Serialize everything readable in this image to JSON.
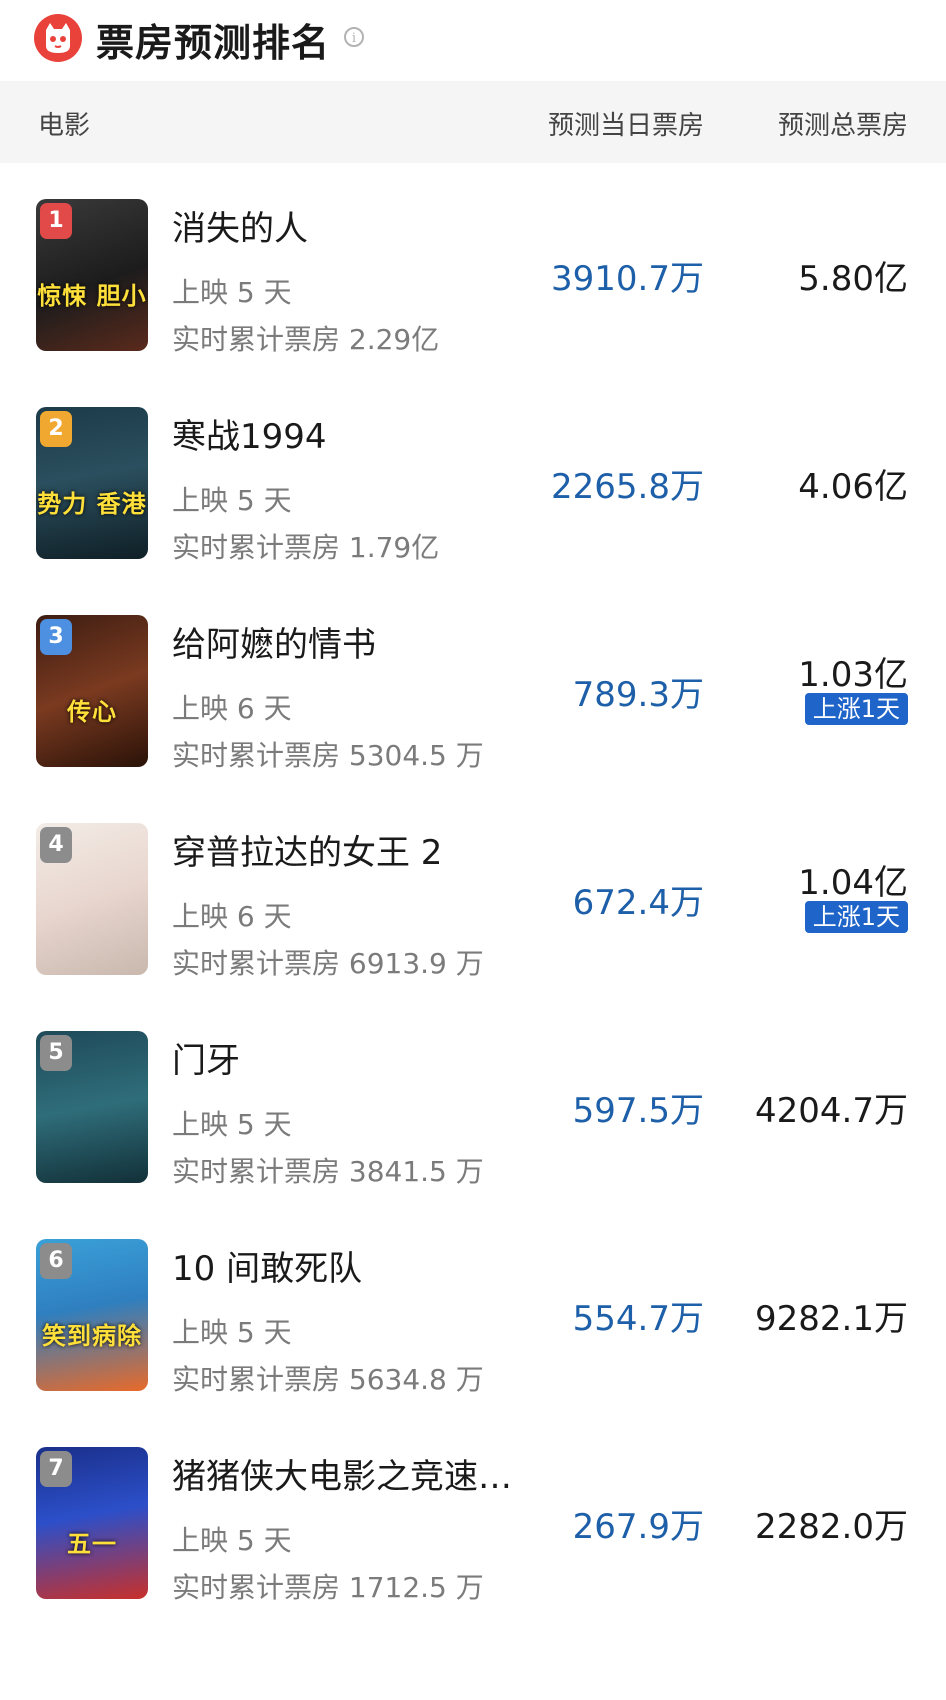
{
  "header": {
    "title": "票房预测排名",
    "info_icon": "info-icon"
  },
  "columns": {
    "film": "电影",
    "today": "预测当日票房",
    "total": "预测总票房"
  },
  "colors": {
    "accent_blue": "#1d5fa8",
    "badge_blue": "#1f64c8",
    "rank_red": "#e24a4a",
    "rank_orange": "#f0a830",
    "rank_blue": "#4d8fe0",
    "rank_gray": "#8c8c8c"
  },
  "films": [
    {
      "rank": "1",
      "name": "消失的人",
      "days": "上映 5 天",
      "cumulative": "实时累计票房 2.29亿",
      "today_box": "3910.7万",
      "total_box": "5.80亿",
      "badge": null,
      "poster_bg": "linear-gradient(160deg,#3a3a3a 0%,#1c1c1c 55%,#5a2a1c 100%)",
      "rank_color": "#e24a4a",
      "poster_text": "惊悚 胆小"
    },
    {
      "rank": "2",
      "name": "寒战1994",
      "days": "上映 5 天",
      "cumulative": "实时累计票房 1.79亿",
      "today_box": "2265.8万",
      "total_box": "4.06亿",
      "badge": null,
      "poster_bg": "linear-gradient(170deg,#1c3a4a 0%,#2b4f5e 45%,#0f1f26 100%)",
      "rank_color": "#f0a830",
      "poster_text": "势力 香港"
    },
    {
      "rank": "3",
      "name": "给阿嬷的情书",
      "days": "上映 6 天",
      "cumulative": "实时累计票房 5304.5 万",
      "today_box": "789.3万",
      "total_box": "1.03亿",
      "badge": "上涨1天",
      "poster_bg": "linear-gradient(160deg,#3d1d12 0%,#7a3a20 50%,#2a1208 100%)",
      "rank_color": "#4d8fe0",
      "poster_text": "传心"
    },
    {
      "rank": "4",
      "name": "穿普拉达的女王 2",
      "days": "上映 6 天",
      "cumulative": "实时累计票房 6913.9 万",
      "today_box": "672.4万",
      "total_box": "1.04亿",
      "badge": "上涨1天",
      "poster_bg": "linear-gradient(160deg,#f3ece6 0%,#e8d6cf 50%,#c9b8ad 100%)",
      "rank_color": "#8c8c8c",
      "poster_text": ""
    },
    {
      "rank": "5",
      "name": "门牙",
      "days": "上映 5 天",
      "cumulative": "实时累计票房 3841.5 万",
      "today_box": "597.5万",
      "total_box": "4204.7万",
      "badge": null,
      "poster_bg": "linear-gradient(170deg,#1f4a5a 0%,#2f6d7a 50%,#123038 100%)",
      "rank_color": "#8c8c8c",
      "poster_text": ""
    },
    {
      "rank": "6",
      "name": "10 间敢死队",
      "days": "上映 5 天",
      "cumulative": "实时累计票房 5634.8 万",
      "today_box": "554.7万",
      "total_box": "9282.1万",
      "badge": null,
      "poster_bg": "linear-gradient(170deg,#3aa0d8 0%,#2f7fbf 45%,#e86a2a 100%)",
      "rank_color": "#8c8c8c",
      "poster_text": "笑到病除"
    },
    {
      "rank": "7",
      "name": "猪猪侠大电影之竞速…",
      "days": "上映 5 天",
      "cumulative": "实时累计票房 1712.5 万",
      "today_box": "267.9万",
      "total_box": "2282.0万",
      "badge": null,
      "poster_bg": "linear-gradient(170deg,#1a2f8a 0%,#2c4fc9 45%,#c8302a 100%)",
      "rank_color": "#8c8c8c",
      "poster_text": "五一"
    }
  ]
}
